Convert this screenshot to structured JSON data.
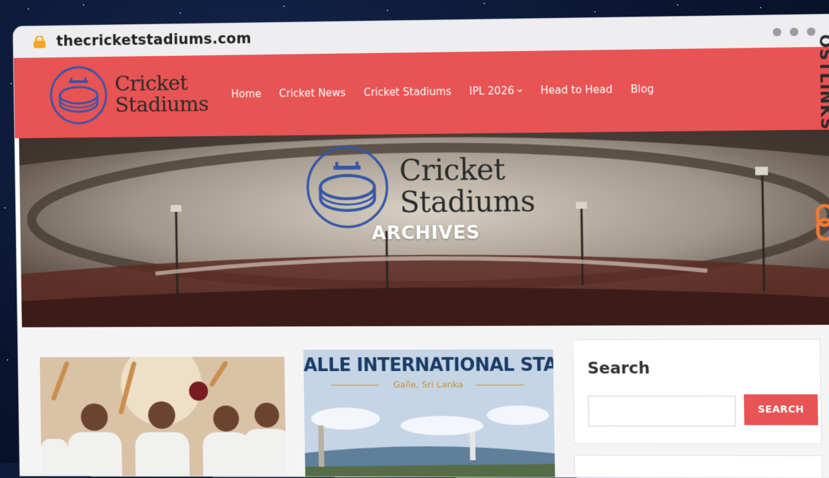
{
  "browser": {
    "url": "thecricketstadiums.com",
    "lock_icon": "lock-icon",
    "window_controls": [
      "dot",
      "dot",
      "dot"
    ]
  },
  "site": {
    "logo": {
      "line1": "Cricket",
      "line2": "Stadiums",
      "icon": "stadium-icon"
    },
    "nav": [
      {
        "label": "Home"
      },
      {
        "label": "Cricket News"
      },
      {
        "label": "Cricket Stadiums"
      },
      {
        "label": "IPL 2026",
        "has_dropdown": true
      },
      {
        "label": "Head to Head"
      },
      {
        "label": "Blog"
      }
    ],
    "hero": {
      "logo_line1": "Cricket",
      "logo_line2": "Stadiums",
      "title": "ARCHIVES"
    },
    "posts": [
      {
        "image": "cricket-players-celebrating-photo"
      },
      {
        "image_title": "ALLE INTERNATIONAL STADIUM",
        "image_subtitle": "Galle, Sri Lanka"
      }
    ],
    "sidebar": {
      "search_title": "Search",
      "search_placeholder": "",
      "search_button": "SEARCH"
    }
  },
  "overlay_badge": {
    "text": "OSTLINKS",
    "icon": "link-icon"
  },
  "colors": {
    "brand_red": "#e85353",
    "logo_blue": "#3556a8",
    "badge_orange": "#f07a35"
  }
}
